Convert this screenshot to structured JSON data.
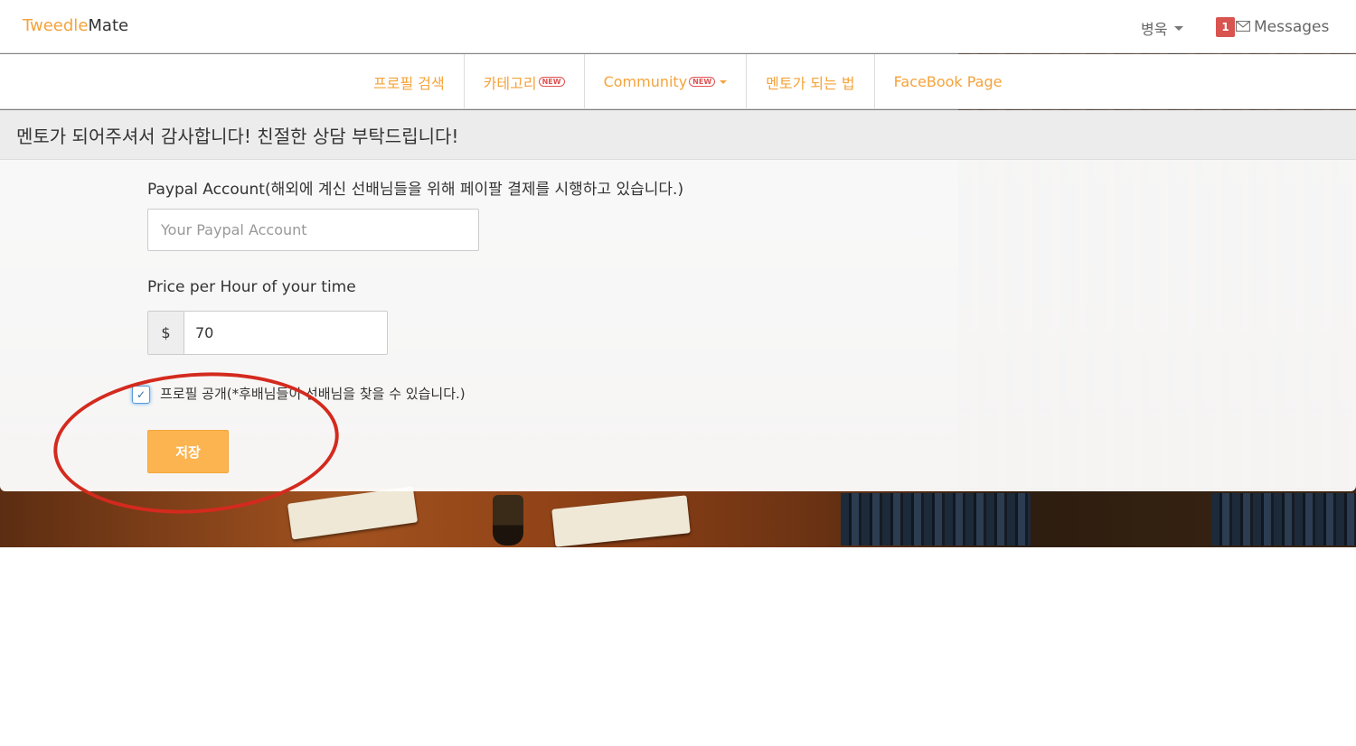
{
  "brand": {
    "part1": "Tweedle",
    "part2": "Mate"
  },
  "user_menu": {
    "name": "병욱"
  },
  "messages": {
    "count": "1",
    "label": "Messages"
  },
  "nav": {
    "items": [
      {
        "label": "프로필 검색"
      },
      {
        "label": "카테고리",
        "badge": "NEW"
      },
      {
        "label": "Community",
        "badge": "NEW"
      },
      {
        "label": "멘토가 되는 법"
      },
      {
        "label": "FaceBook Page"
      }
    ]
  },
  "panel": {
    "heading": "멘토가 되어주셔서 감사합니다! 친절한 상담 부탁드립니다!",
    "paypal_label": "Paypal Account(해외에 계신 선배님들을 위해 페이팔 결제를 시행하고 있습니다.)",
    "paypal_placeholder": "Your Paypal Account",
    "price_label": "Price per Hour of your time",
    "currency": "$",
    "price_value": "70",
    "public_checkbox_label": "프로필 공개(*후배님들이 선배님을 찾을 수 있습니다.)",
    "public_checked": true,
    "save_label": "저장"
  },
  "colors": {
    "accent": "#f5a33b",
    "button": "#fbb450",
    "badge": "#d9534f",
    "annotation": "#d42a1e"
  }
}
